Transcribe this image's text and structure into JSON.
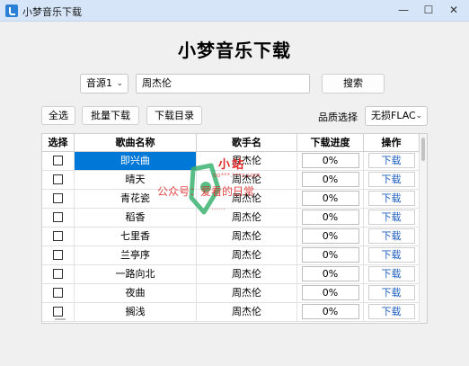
{
  "window": {
    "title": "小梦音乐下载",
    "minimize_glyph": "—",
    "maximize_glyph": "☐",
    "close_glyph": "✕"
  },
  "app": {
    "heading": "小梦音乐下载"
  },
  "search": {
    "source": "音源1",
    "query": "周杰伦",
    "button_label": "搜索"
  },
  "toolbar": {
    "select_all": "全选",
    "batch_download": "批量下载",
    "download_dir": "下载目录",
    "quality_label": "品质选择",
    "quality_value": "无损FLAC"
  },
  "table": {
    "headers": [
      "选择",
      "歌曲名称",
      "歌手名",
      "下载进度",
      "操作"
    ],
    "rows": [
      {
        "song": "即兴曲",
        "singer": "周杰伦",
        "progress": "0%",
        "action": "下载",
        "selected": true
      },
      {
        "song": "晴天",
        "singer": "周杰伦",
        "progress": "0%",
        "action": "下载",
        "selected": false
      },
      {
        "song": "青花瓷",
        "singer": "周杰伦",
        "progress": "0%",
        "action": "下载",
        "selected": false
      },
      {
        "song": "稻香",
        "singer": "周杰伦",
        "progress": "0%",
        "action": "下载",
        "selected": false
      },
      {
        "song": "七里香",
        "singer": "周杰伦",
        "progress": "0%",
        "action": "下载",
        "selected": false
      },
      {
        "song": "兰亭序",
        "singer": "周杰伦",
        "progress": "0%",
        "action": "下载",
        "selected": false
      },
      {
        "song": "一路向北",
        "singer": "周杰伦",
        "progress": "0%",
        "action": "下载",
        "selected": false
      },
      {
        "song": "夜曲",
        "singer": "周杰伦",
        "progress": "0%",
        "action": "下载",
        "selected": false
      },
      {
        "song": "搁浅",
        "singer": "周杰伦",
        "progress": "0%",
        "action": "下载",
        "selected": false
      }
    ]
  },
  "watermark": {
    "top": "小站",
    "url": "oo***.***z.com",
    "text": "公众号：爱看的日常",
    "bottom": "……"
  },
  "colors": {
    "titlebar": "#d6e6f8",
    "selection": "#0078d7",
    "link_blue": "#1f5fbf",
    "watermark_red": "#e02828"
  }
}
